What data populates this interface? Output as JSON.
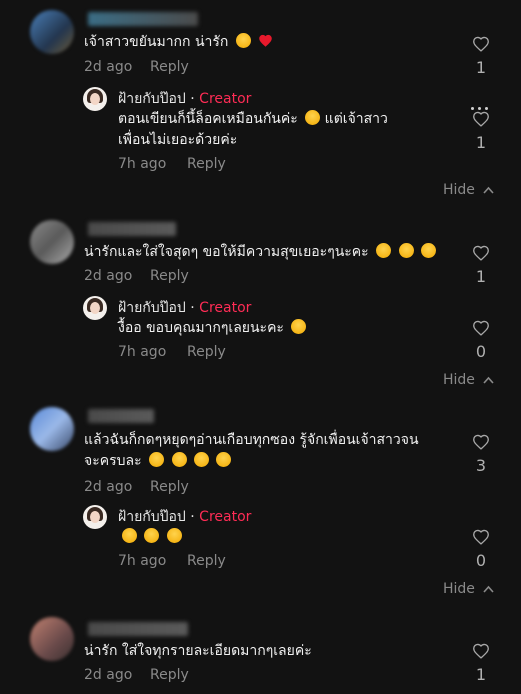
{
  "comments": [
    {
      "text": "เจ้าสาวขยันมากก น่ารัก",
      "time": "2d ago",
      "reply_label": "Reply",
      "likes": "1",
      "reply": {
        "author": "ฝ้ายกับป๊อป",
        "sep": " · ",
        "badge": "Creator",
        "line1": "ตอนเขียนก็นึ้ล็อคเหมือนกันค่ะ",
        "line1b": "แต่เจ้าสาว",
        "line2": "เพื่อนไม่เยอะด้วยค่ะ",
        "time": "7h ago",
        "reply_label": "Reply",
        "likes": "1"
      },
      "hide_label": "Hide"
    },
    {
      "text": "น่ารักและใส่ใจสุดๆ ขอให้มีความสุขเยอะๆนะคะ",
      "time": "2d ago",
      "reply_label": "Reply",
      "likes": "1",
      "reply": {
        "author": "ฝ้ายกับป๊อป",
        "sep": " · ",
        "badge": "Creator",
        "line1": "งื้ออ ขอบคุณมากๆเลยนะคะ",
        "time": "7h ago",
        "reply_label": "Reply",
        "likes": "0"
      },
      "hide_label": "Hide"
    },
    {
      "text": "แล้วฉันก็กดๆหยุดๆอ่านเกือบทุกซอง รู้จักเพื่อนเจ้าสาวจน",
      "text2": "จะครบละ",
      "time": "2d ago",
      "reply_label": "Reply",
      "likes": "3",
      "reply": {
        "author": "ฝ้ายกับป๊อป",
        "sep": " · ",
        "badge": "Creator",
        "time": "7h ago",
        "reply_label": "Reply",
        "likes": "0"
      },
      "hide_label": "Hide"
    },
    {
      "text": "น่ารัก ใส่ใจทุกรายละเอียดมากๆเลยค่ะ",
      "time": "2d ago",
      "reply_label": "Reply",
      "likes": "1"
    }
  ]
}
